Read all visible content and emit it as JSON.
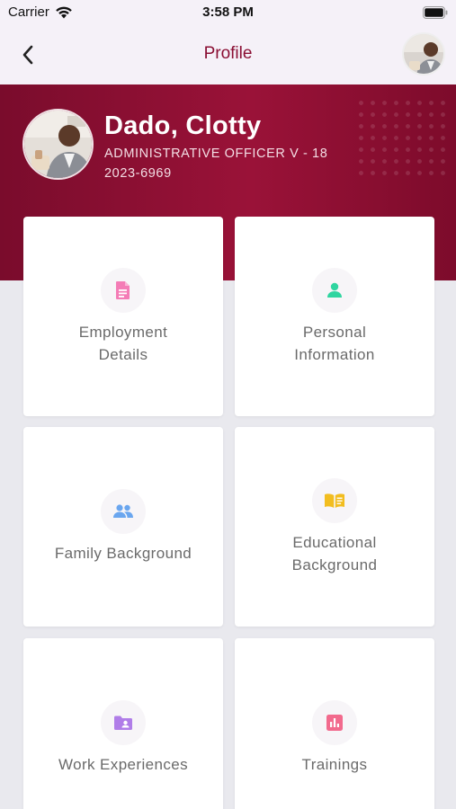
{
  "status_bar": {
    "carrier": "Carrier",
    "time": "3:58 PM"
  },
  "nav": {
    "title": "Profile"
  },
  "profile": {
    "name": "Dado, Clotty",
    "position": "ADMINISTRATIVE OFFICER V - 18",
    "employee_id": "2023-6969"
  },
  "tiles": [
    {
      "line1": "Employment",
      "line2": "Details",
      "icon": "document-icon",
      "icon_color": "#f47cb6"
    },
    {
      "line1": "Personal",
      "line2": "Information",
      "icon": "person-icon",
      "icon_color": "#2fd5a0"
    },
    {
      "line1": "Family Background",
      "line2": "",
      "icon": "group-icon",
      "icon_color": "#6aa6ef"
    },
    {
      "line1": "Educational",
      "line2": "Background",
      "icon": "book-icon",
      "icon_color": "#f2bd1f"
    },
    {
      "line1": "Work Experiences",
      "line2": "",
      "icon": "folder-person-icon",
      "icon_color": "#b07de8"
    },
    {
      "line1": "Trainings",
      "line2": "",
      "icon": "bar-chart-icon",
      "icon_color": "#f26a8d"
    }
  ],
  "colors": {
    "brand": "#8a0e33",
    "header_bg": "#f5f1f8",
    "page_bg": "#e9e9ee"
  }
}
